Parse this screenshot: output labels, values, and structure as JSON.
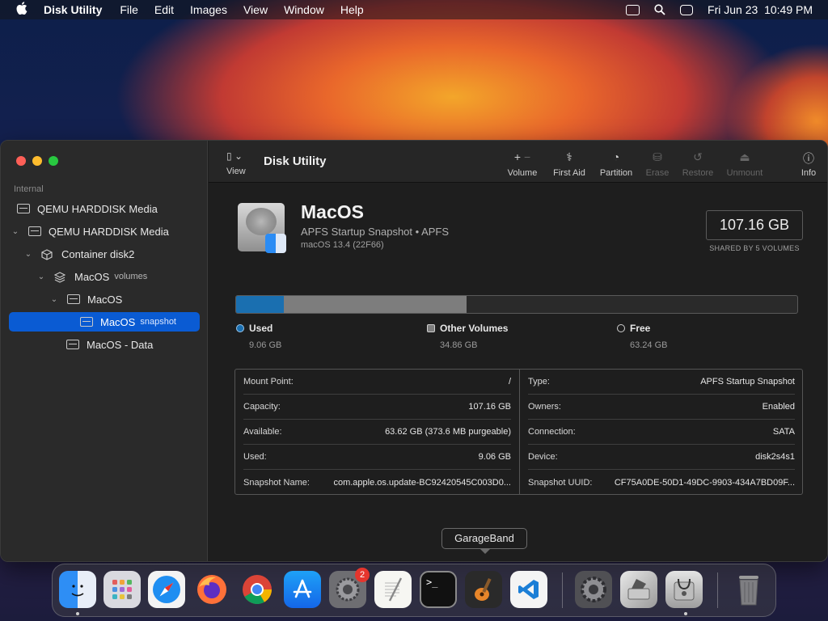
{
  "menubar": {
    "app_name": "Disk Utility",
    "menus": [
      "File",
      "Edit",
      "Images",
      "View",
      "Window",
      "Help"
    ],
    "datetime": "Fri Jun 23  10:49 PM",
    "icons": [
      "apple-icon",
      "screen-mirroring-icon",
      "search-icon",
      "control-center-icon"
    ]
  },
  "sidebar": {
    "section": "Internal",
    "items": [
      {
        "label": "QEMU HARDDISK Media",
        "sub": "",
        "chevron": ""
      },
      {
        "label": "QEMU HARDDISK Media",
        "sub": "",
        "chevron": "⌄"
      },
      {
        "label": "Container disk2",
        "sub": "",
        "chevron": "⌄"
      },
      {
        "label": "MacOS",
        "sub": "volumes",
        "chevron": "⌄"
      },
      {
        "label": "MacOS",
        "sub": "",
        "chevron": "⌄"
      },
      {
        "label": "MacOS",
        "sub": "snapshot",
        "chevron": ""
      },
      {
        "label": "MacOS - Data",
        "sub": "",
        "chevron": ""
      }
    ]
  },
  "toolbar": {
    "view_label": "View",
    "title": "Disk Utility",
    "volume_label": "Volume",
    "first_aid_label": "First Aid",
    "partition_label": "Partition",
    "erase_label": "Erase",
    "restore_label": "Restore",
    "unmount_label": "Unmount",
    "info_label": "Info"
  },
  "volume": {
    "name": "MacOS",
    "type": "APFS Startup Snapshot • APFS",
    "os": "macOS 13.4 (22F66)",
    "size": "107.16 GB",
    "size_caption": "SHARED BY 5 VOLUMES"
  },
  "usage": {
    "used_fraction": 0.085,
    "other_fraction": 0.325,
    "colors": {
      "used": "#1a6fb0",
      "other": "#7d7d7d",
      "free": "#2a2a2a"
    },
    "used_label": "Used",
    "used_value": "9.06 GB",
    "other_label": "Other Volumes",
    "other_value": "34.86 GB",
    "free_label": "Free",
    "free_value": "63.24 GB"
  },
  "info_left": [
    {
      "k": "Mount Point:",
      "v": "/"
    },
    {
      "k": "Capacity:",
      "v": "107.16 GB"
    },
    {
      "k": "Available:",
      "v": "63.62 GB (373.6 MB purgeable)"
    },
    {
      "k": "Used:",
      "v": "9.06 GB"
    },
    {
      "k": "Snapshot Name:",
      "v": "com.apple.os.update-BC92420545C003D0..."
    }
  ],
  "info_right": [
    {
      "k": "Type:",
      "v": "APFS Startup Snapshot"
    },
    {
      "k": "Owners:",
      "v": "Enabled"
    },
    {
      "k": "Connection:",
      "v": "SATA"
    },
    {
      "k": "Device:",
      "v": "disk2s4s1"
    },
    {
      "k": "Snapshot UUID:",
      "v": "CF75A0DE-50D1-49DC-9903-434A7BD09F..."
    }
  ],
  "tooltip": "GarageBand",
  "dock": {
    "badge_count": "2",
    "apps": [
      "finder-icon",
      "launchpad-icon",
      "safari-icon",
      "firefox-icon",
      "chrome-icon",
      "app-store-icon",
      "system-preferences-icon",
      "textedit-icon",
      "terminal-icon",
      "garageband-icon",
      "vscode-icon",
      "settings-icon",
      "disk-image-icon",
      "disk-utility-icon",
      "trash-icon"
    ]
  }
}
